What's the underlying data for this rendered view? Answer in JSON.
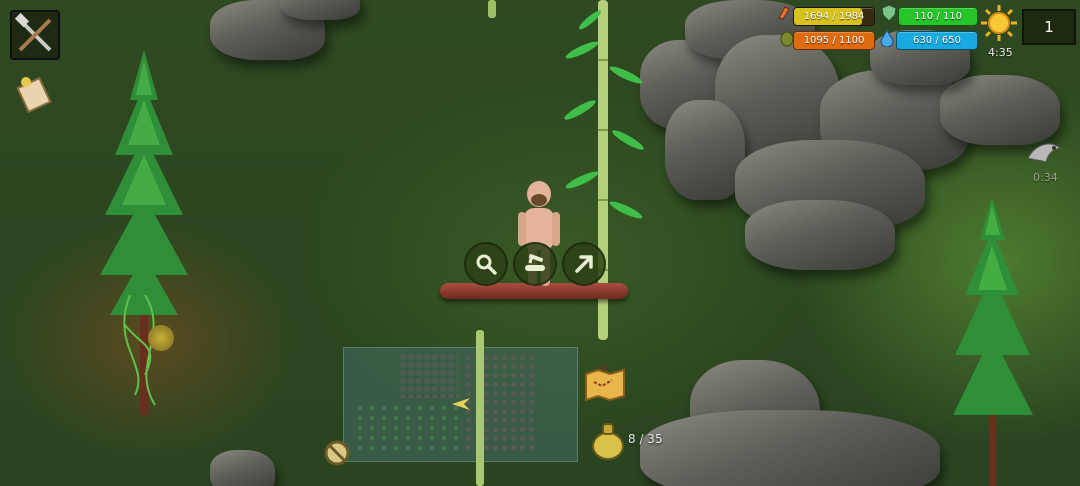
{
  "hud": {
    "health": {
      "text": "1694 / 1984",
      "fraction": 0.854,
      "color": "#d8c21f"
    },
    "armor": {
      "text": "110 / 110",
      "fraction": 1.0,
      "color": "#27c52a"
    },
    "food": {
      "text": "1095 / 1100",
      "fraction": 0.995,
      "color": "#e06a10"
    },
    "water": {
      "text": "630 / 650",
      "fraction": 0.969,
      "color": "#18a9e0"
    },
    "time": "4:35",
    "level": "1",
    "event_timer": "0:34"
  },
  "inventory": {
    "count_text": "8 / 35"
  },
  "icons": {
    "craft": "crossed-tools-icon",
    "quests": "scroll-icon",
    "inspect": "magnifier-icon",
    "chop": "saw-log-icon",
    "move": "arrow-up-right-icon",
    "map": "treasure-map-icon",
    "bag": "pouch-icon",
    "disabled": "blocked-icon",
    "weather": "sun-icon",
    "raid": "eagle-icon"
  },
  "colors": {
    "hud_panel": "#1d2a10",
    "button_bg": "#2d4114",
    "grass": "#2f4a22"
  }
}
